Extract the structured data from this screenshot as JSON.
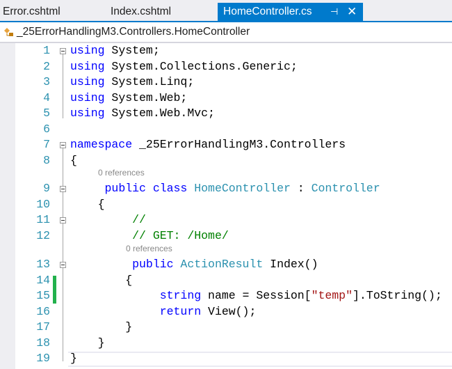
{
  "tabs": [
    {
      "label": "Error.cshtml",
      "active": false
    },
    {
      "label": "Index.cshtml",
      "active": false
    },
    {
      "label": "HomeController.cs",
      "active": true,
      "pin_icon": "⊣",
      "close_icon": "✕"
    }
  ],
  "breadcrumb": {
    "icon": "class-icon",
    "text": "_25ErrorHandlingM3.Controllers.HomeController"
  },
  "colors": {
    "accent": "#007acc",
    "keyword": "#0000ff",
    "type": "#2b91af",
    "comment": "#008000",
    "string": "#a31515",
    "changed": "#22b14c"
  },
  "codelens": [
    "0 references",
    "0 references"
  ],
  "lines": [
    {
      "n": "1",
      "t": [
        [
          "kw",
          "using"
        ],
        [
          "",
          "System;"
        ]
      ]
    },
    {
      "n": "2",
      "t": [
        [
          "kw",
          "using"
        ],
        [
          "",
          "System.Collections.Generic;"
        ]
      ]
    },
    {
      "n": "3",
      "t": [
        [
          "kw",
          "using"
        ],
        [
          "",
          "System.Linq;"
        ]
      ]
    },
    {
      "n": "4",
      "t": [
        [
          "kw",
          "using"
        ],
        [
          "",
          "System.Web;"
        ]
      ]
    },
    {
      "n": "5",
      "t": [
        [
          "kw",
          "using"
        ],
        [
          "",
          "System.Web.Mvc;"
        ]
      ]
    },
    {
      "n": "6",
      "t": []
    },
    {
      "n": "7",
      "t": [
        [
          "kw",
          "namespace"
        ],
        [
          "",
          "_25ErrorHandlingM3.Controllers"
        ]
      ]
    },
    {
      "n": "8",
      "t": [
        [
          "",
          "{"
        ]
      ]
    },
    {
      "n": "9",
      "t": [
        [
          "",
          "    "
        ],
        [
          "kw",
          "public"
        ],
        [
          "kw",
          "class"
        ],
        [
          "ty",
          "HomeController"
        ],
        [
          "",
          ":"
        ],
        [
          "ty",
          "Controller"
        ]
      ]
    },
    {
      "n": "10",
      "t": [
        [
          "",
          "    {"
        ]
      ]
    },
    {
      "n": "11",
      "t": [
        [
          "",
          "        "
        ],
        [
          "cm",
          "//"
        ]
      ]
    },
    {
      "n": "12",
      "t": [
        [
          "",
          "        "
        ],
        [
          "cm",
          "// GET: /Home/"
        ]
      ]
    },
    {
      "n": "13",
      "t": [
        [
          "",
          "        "
        ],
        [
          "kw",
          "public"
        ],
        [
          "ty",
          "ActionResult"
        ],
        [
          "",
          "Index()"
        ]
      ]
    },
    {
      "n": "14",
      "t": [
        [
          "",
          "        {"
        ]
      ]
    },
    {
      "n": "15",
      "t": [
        [
          "",
          "            "
        ],
        [
          "kw",
          "string"
        ],
        [
          "",
          "name = Session["
        ],
        [
          "st",
          "\"temp\""
        ],
        [
          "",
          "].ToString();"
        ]
      ]
    },
    {
      "n": "16",
      "t": [
        [
          "",
          "            "
        ],
        [
          "kw",
          "return"
        ],
        [
          "",
          "View();"
        ]
      ]
    },
    {
      "n": "17",
      "t": [
        [
          "",
          "        }"
        ]
      ]
    },
    {
      "n": "18",
      "t": [
        [
          "",
          "    }"
        ]
      ]
    },
    {
      "n": "19",
      "t": [
        [
          "",
          "}"
        ]
      ]
    }
  ]
}
